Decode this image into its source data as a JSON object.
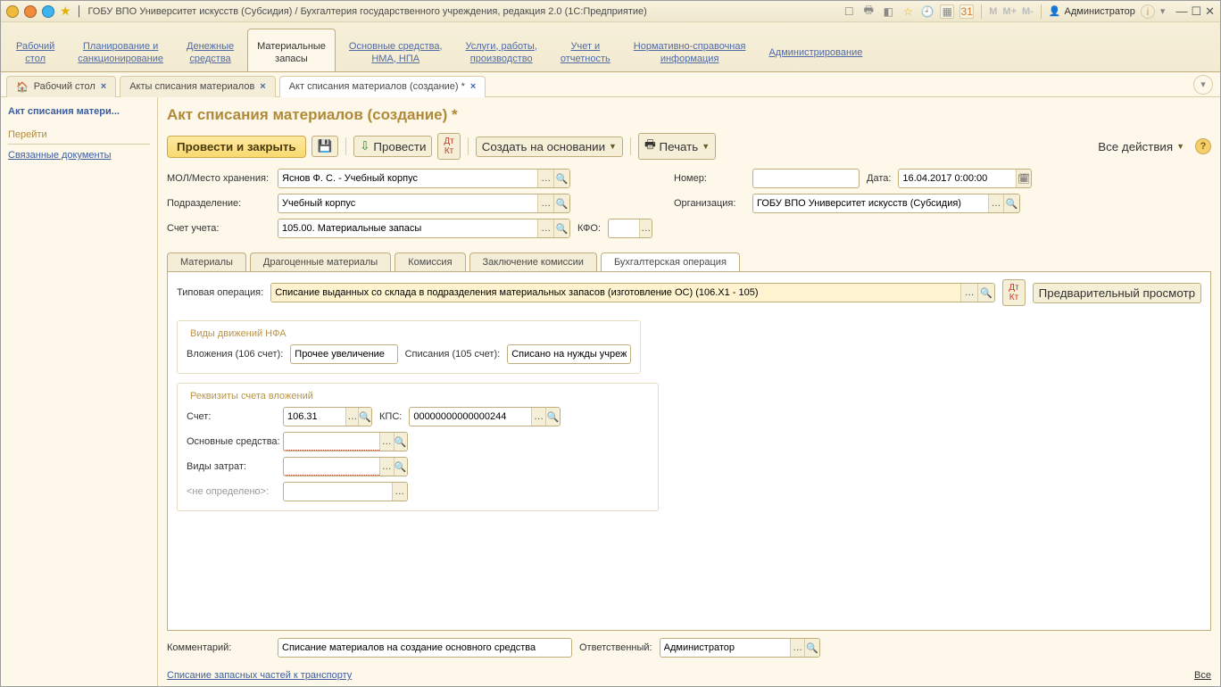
{
  "titlebar": {
    "text": "ГОБУ ВПО Университет искусств (Субсидия) / Бухгалтерия государственного учреждения, редакция 2.0  (1С:Предприятие)",
    "btn_colors": [
      "#f0bb3d",
      "#f08a3d",
      "#3db4f0"
    ],
    "user": "Администратор",
    "m": "M",
    "mplus": "M+",
    "mminus": "M-"
  },
  "sections": [
    {
      "l1": "Рабочий",
      "l2": "стол"
    },
    {
      "l1": "Планирование и",
      "l2": "санкционирование"
    },
    {
      "l1": "Денежные",
      "l2": "средства"
    },
    {
      "l1": "Материальные",
      "l2": "запасы"
    },
    {
      "l1": "Основные средства,",
      "l2": "НМА, НПА"
    },
    {
      "l1": "Услуги, работы,",
      "l2": "производство"
    },
    {
      "l1": "Учет и",
      "l2": "отчетность"
    },
    {
      "l1": "Нормативно-справочная",
      "l2": "информация"
    },
    {
      "l1": "Администрирование",
      "l2": ""
    }
  ],
  "doc_tabs": [
    {
      "label": "Рабочий стол"
    },
    {
      "label": "Акты списания материалов"
    },
    {
      "label": "Акт списания материалов (создание) *"
    }
  ],
  "sidebar": {
    "heading": "Акт списания матери...",
    "section": "Перейти",
    "link": "Связанные документы"
  },
  "form": {
    "title": "Акт списания материалов (создание) *",
    "toolbar": {
      "post_close": "Провести и закрыть",
      "post": "Провести",
      "create_based": "Создать на основании",
      "print": "Печать",
      "all_actions": "Все действия",
      "preview": "Предварительный просмотр"
    },
    "labels": {
      "mol": "МОЛ/Место хранения:",
      "subdiv": "Подразделение:",
      "account": "Счет учета:",
      "kfo": "КФО:",
      "number": "Номер:",
      "date": "Дата:",
      "org": "Организация:",
      "op_type": "Типовая операция:",
      "nfa_group": "Виды движений НФА",
      "vloj": "Вложения (106 счет):",
      "spis": "Списания (105 счет):",
      "rekv_group": "Реквизиты счета вложений",
      "acct": "Счет:",
      "kps": "КПС:",
      "os": "Основные средства:",
      "vidz": "Виды затрат:",
      "undef": "<не определено>:",
      "comment": "Комментарий:",
      "resp": "Ответственный:",
      "spare_link": "Списание запасных частей к транспорту",
      "all": "Все"
    },
    "values": {
      "mol": "Яснов Ф. С. - Учебный корпус",
      "subdiv": "Учебный корпус",
      "account": "105.00. Материальные запасы",
      "kfo": "",
      "number": "",
      "date": "16.04.2017 0:00:00",
      "org": "ГОБУ ВПО Университет искусств (Субсидия)",
      "op_type": "Списание выданных со склада в подразделения материальных запасов (изготовление ОС) (106.X1 - 105)",
      "vloj": "Прочее увеличение",
      "spis": "Списано на нужды учреж",
      "acct": "106.31",
      "kps": "00000000000000244",
      "os": "",
      "vidz": "",
      "undef": "",
      "comment": "Списание материалов на создание основного средства",
      "resp": "Администратор"
    },
    "inner_tabs": [
      "Материалы",
      "Драгоценные материалы",
      "Комиссия",
      "Заключение комиссии",
      "Бухгалтерская операция"
    ]
  }
}
